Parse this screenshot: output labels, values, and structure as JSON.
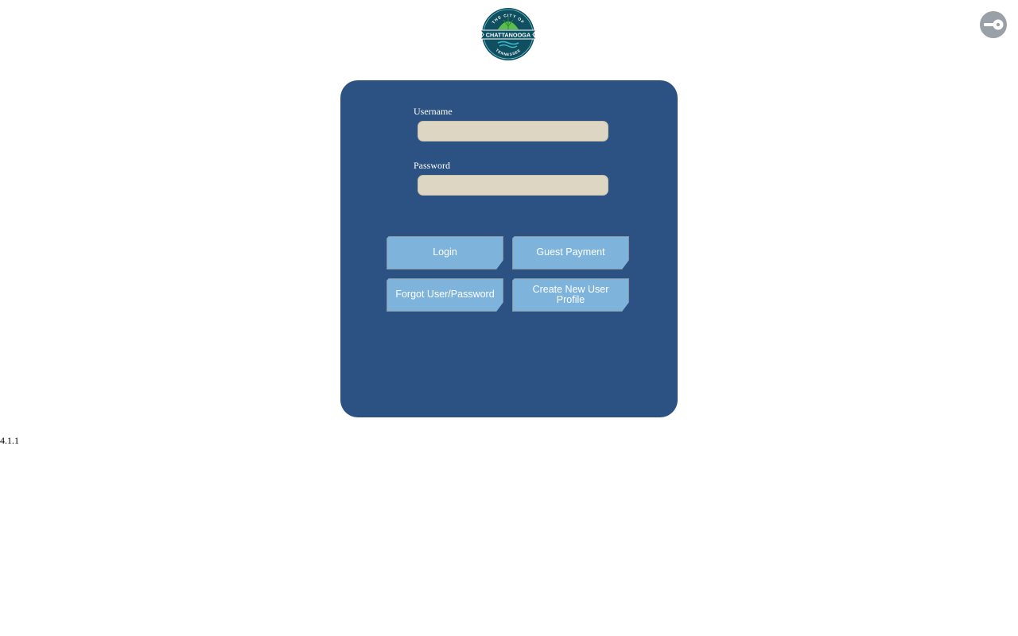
{
  "header": {
    "logo": {
      "top_text": "THE CITY OF",
      "main_text": "CHATTANOOGA",
      "bottom_text": "TENNESSEE",
      "colors": {
        "ring": "#0f4f5f",
        "badge": "#0e5363",
        "leaf": "#5cbf4a",
        "water": "#43b3c9"
      }
    },
    "key_button": {
      "icon": "key-icon",
      "color": "#9aa0a8"
    }
  },
  "login_form": {
    "background_color": "#2b5282",
    "username_label": "Username",
    "username_value": "",
    "password_label": "Password",
    "password_value": "",
    "buttons": {
      "login": "Login",
      "guest_payment": "Guest Payment",
      "forgot": "Forgot User/Password",
      "create_profile": "Create New User Profile"
    },
    "button_color": "#7eb4dc",
    "input_color": "#dcd6c2"
  },
  "footer": {
    "version": "4.1.1"
  }
}
